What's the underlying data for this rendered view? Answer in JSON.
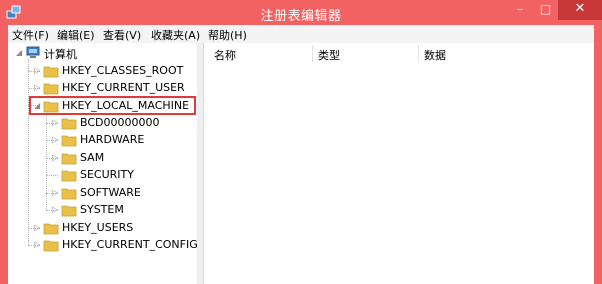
{
  "window": {
    "title": "注册表编辑器",
    "min_glyph": "–",
    "max_glyph": "□",
    "close_glyph": "✕"
  },
  "menu": [
    "文件(F)",
    "编辑(E)",
    "查看(V)",
    "收藏夹(A)",
    "帮助(H)"
  ],
  "tree": {
    "root": "计算机",
    "hives": [
      "HKEY_CLASSES_ROOT",
      "HKEY_CURRENT_USER",
      "HKEY_LOCAL_MACHINE",
      "HKEY_USERS",
      "HKEY_CURRENT_CONFIG"
    ],
    "local_machine_children": [
      "BCD00000000",
      "HARDWARE",
      "SAM",
      "SECURITY",
      "SOFTWARE",
      "SYSTEM"
    ],
    "expanded_hive": "HKEY_LOCAL_MACHINE",
    "highlighted_hive": "HKEY_LOCAL_MACHINE"
  },
  "columns": [
    "名称",
    "类型",
    "数据"
  ],
  "colors": {
    "frame": "#f26262",
    "close_button": "#c93838",
    "highlight_box": "#e23a3a",
    "folder": "#e8c04a"
  },
  "icons": {
    "app": "regedit-icon",
    "computer": "computer-icon",
    "folder": "folder-icon",
    "expand": "expand-arrow-icon",
    "collapse": "collapse-arrow-icon"
  }
}
